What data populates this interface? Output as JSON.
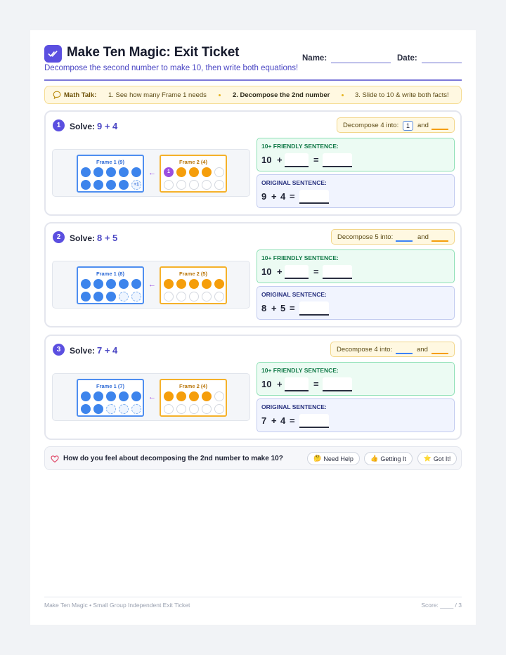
{
  "header": {
    "title": "Make Ten Magic: Exit Ticket",
    "subtitle": "Decompose the second number to make 10, then write both equations!",
    "name_label": "Name:",
    "date_label": "Date:"
  },
  "math_talk": {
    "label": "Math Talk:",
    "steps": [
      "1. See how many Frame 1 needs",
      "2. Decompose the 2nd number",
      "3. Slide to 10 & write both facts!"
    ]
  },
  "problems": [
    {
      "number": "1",
      "solve_label": "Solve:",
      "equation": "9 + 4",
      "decompose_label": "Decompose 4 into:",
      "decompose_first": "1",
      "and_label": "and",
      "frame1_label": "Frame 1 (9)",
      "frame2_label": "Frame 2 (4)",
      "frame1_filled": 9,
      "frame2_filled": 4,
      "moved_marker": "1",
      "plus_marker": "+1",
      "friendly_label": "10+ FRIENDLY SENTENCE:",
      "friendly_start": "10",
      "original_label": "ORIGINAL SENTENCE:",
      "original_a": "9",
      "original_b": "4"
    },
    {
      "number": "2",
      "solve_label": "Solve:",
      "equation": "8 + 5",
      "decompose_label": "Decompose 5 into:",
      "decompose_first": "",
      "and_label": "and",
      "frame1_label": "Frame 1 (8)",
      "frame2_label": "Frame 2 (5)",
      "frame1_filled": 8,
      "frame2_filled": 5,
      "friendly_label": "10+ FRIENDLY SENTENCE:",
      "friendly_start": "10",
      "original_label": "ORIGINAL SENTENCE:",
      "original_a": "8",
      "original_b": "5"
    },
    {
      "number": "3",
      "solve_label": "Solve:",
      "equation": "7 + 4",
      "decompose_label": "Decompose 4 into:",
      "decompose_first": "",
      "and_label": "and",
      "frame1_label": "Frame 1 (7)",
      "frame2_label": "Frame 2 (4)",
      "frame1_filled": 7,
      "frame2_filled": 4,
      "friendly_label": "10+ FRIENDLY SENTENCE:",
      "friendly_start": "10",
      "original_label": "ORIGINAL SENTENCE:",
      "original_a": "7",
      "original_b": "4"
    }
  ],
  "symbols": {
    "plus": "+",
    "equals": "=",
    "arrow": "←"
  },
  "feelings": {
    "question": "How do you feel about decomposing the 2nd number to make 10?",
    "options": [
      {
        "emoji_icon": "thinking-face-icon",
        "label": "Need Help"
      },
      {
        "emoji_icon": "thumbs-up-icon",
        "label": "Getting It"
      },
      {
        "emoji_icon": "star-icon",
        "label": "Got It!"
      }
    ]
  },
  "footer": {
    "left": "Make Ten Magic • Small Group Independent Exit Ticket",
    "right": "Score: ____ / 3"
  },
  "colors": {
    "accent": "#5b4fe0",
    "frame1": "#3d84ec",
    "frame2": "#f59e0b",
    "friendly_bg": "#ecfbf3",
    "original_bg": "#f1f4fe"
  }
}
